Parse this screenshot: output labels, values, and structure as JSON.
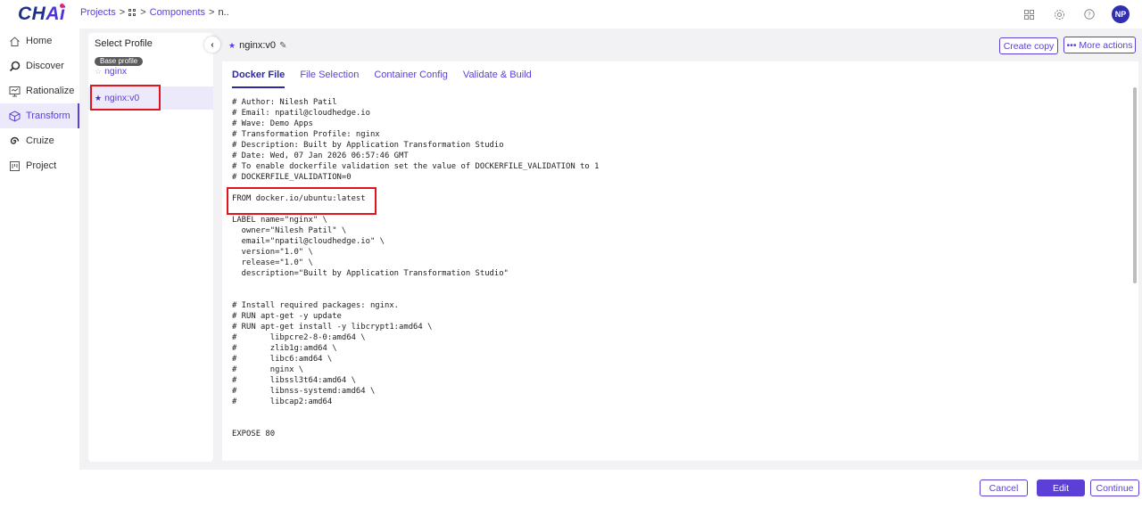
{
  "logo": {
    "text_main": "CH",
    "text_accent": "Ai"
  },
  "breadcrumb": {
    "projects": "Projects",
    "sep": ">",
    "components": "Components",
    "current": "n.."
  },
  "top_icons": [
    "apps-grid-icon",
    "gear-icon",
    "help-circle-icon"
  ],
  "user": {
    "initials": "NP"
  },
  "nav": {
    "items": [
      {
        "label": "Home",
        "icon": "home-icon"
      },
      {
        "label": "Discover",
        "icon": "search-icon"
      },
      {
        "label": "Rationalize",
        "icon": "monitor-icon"
      },
      {
        "label": "Transform",
        "icon": "cube-icon",
        "active": true
      },
      {
        "label": "Cruize",
        "icon": "spiral-icon"
      },
      {
        "label": "Project",
        "icon": "project-icon"
      }
    ]
  },
  "profile_panel": {
    "title": "Select Profile",
    "base_badge": "Base profile",
    "base_item": "nginx",
    "selected_item": "nginx:v0"
  },
  "main": {
    "title": "nginx:v0",
    "create_copy": "Create copy",
    "more_actions": "••• More actions",
    "tabs": [
      {
        "label": "Docker File",
        "active": true
      },
      {
        "label": "File Selection"
      },
      {
        "label": "Container Config"
      },
      {
        "label": "Validate & Build"
      }
    ],
    "dockerfile": "# Author: Nilesh Patil\n# Email: npatil@cloudhedge.io\n# Wave: Demo Apps\n# Transformation Profile: nginx\n# Description: Built by Application Transformation Studio\n# Date: Wed, 07 Jan 2026 06:57:46 GMT\n# To enable dockerfile validation set the value of DOCKERFILE_VALIDATION to 1\n# DOCKERFILE_VALIDATION=0\n\nFROM docker.io/ubuntu:latest\n\nLABEL name=\"nginx\" \\\n  owner=\"Nilesh Patil\" \\\n  email=\"npatil@cloudhedge.io\" \\\n  version=\"1.0\" \\\n  release=\"1.0\" \\\n  description=\"Built by Application Transformation Studio\"\n\n\n# Install required packages: nginx.\n# RUN apt-get -y update\n# RUN apt-get install -y libcrypt1:amd64 \\\n#       libpcre2-8-0:amd64 \\\n#       zlib1g:amd64 \\\n#       libc6:amd64 \\\n#       nginx \\\n#       libssl3t64:amd64 \\\n#       libnss-systemd:amd64 \\\n#       libcap2:amd64\n\n\nEXPOSE 80"
  },
  "footer": {
    "cancel": "Cancel",
    "edit": "Edit",
    "continue": "Continue"
  },
  "colors": {
    "accent": "#5b3fd6",
    "highlight": "#e0141d",
    "logo": "#1d2f8a"
  }
}
